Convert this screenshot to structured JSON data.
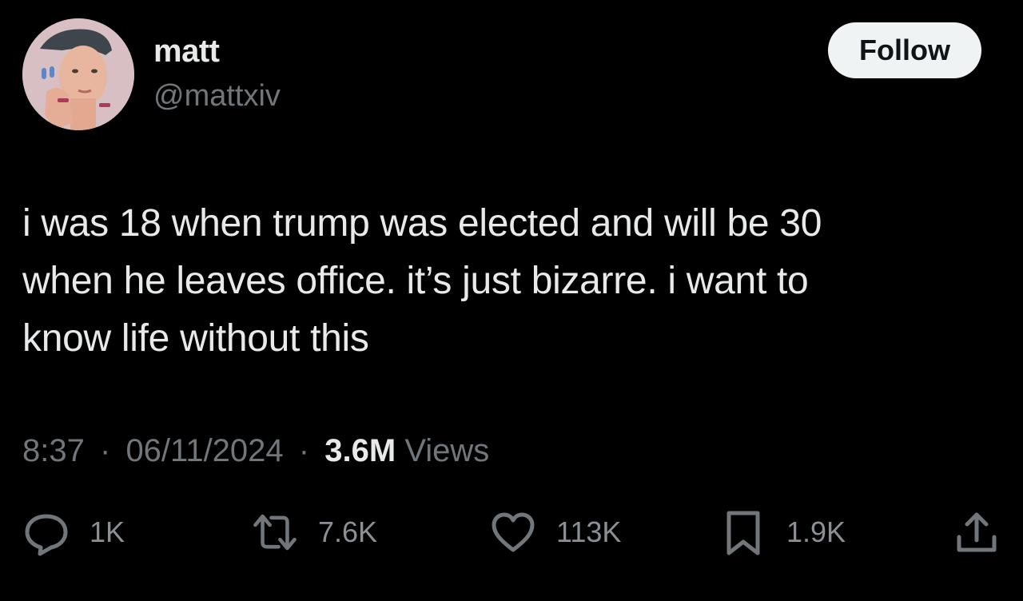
{
  "author": {
    "display_name": "matt",
    "handle": "@mattxiv",
    "avatar_icon": "profile-photo"
  },
  "follow_button": {
    "label": "Follow"
  },
  "tweet": {
    "lines": [
      "i was 18 when trump was elected and will be 30",
      "when he leaves office. it’s just bizarre. i want to",
      "know life without this"
    ]
  },
  "meta": {
    "time": "8:37",
    "separator": "·",
    "date": "06/11/2024",
    "views_count": "3.6M",
    "views_label": "Views"
  },
  "actions": {
    "reply": {
      "icon": "reply-icon",
      "count": "1K"
    },
    "repost": {
      "icon": "repost-icon",
      "count": "7.6K"
    },
    "like": {
      "icon": "heart-icon",
      "count": "113K"
    },
    "bookmark": {
      "icon": "bookmark-icon",
      "count": "1.9K"
    },
    "share": {
      "icon": "share-icon"
    }
  },
  "colors": {
    "background": "#000000",
    "primary_text": "#e7e9ea",
    "secondary_text": "#71767b",
    "follow_bg": "#eff3f4"
  }
}
